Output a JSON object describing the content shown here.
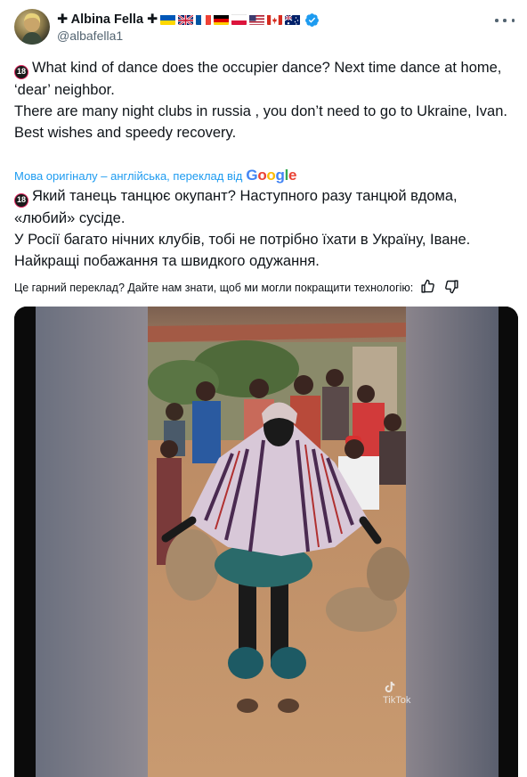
{
  "author": {
    "display_name": "✚ Albina Fella ✚",
    "handle": "@albafella1",
    "verified": true,
    "flags": [
      "ukraine",
      "united-kingdom",
      "france",
      "germany",
      "poland",
      "usa",
      "canada",
      "australia"
    ]
  },
  "tweet": {
    "age_icon": "18",
    "lines": [
      "What kind of dance does the occupier dance? Next time dance at home, ‘dear’ neighbor.",
      "There are many night clubs in russia , you don’t need to go to Ukraine, Ivan.",
      "Best wishes and speedy recovery."
    ]
  },
  "translation": {
    "label": "Мова оригіналу – англійська, переклад від",
    "provider": "Google",
    "lines": [
      "Який танець танцює окупант? Наступного разу танцюй вдома, «любий» сусіде.",
      "У Росії багато нічних клубів, тобі не потрібно їхати в Україну, Іване.",
      "Найкращі побажання та швидкого одужання."
    ]
  },
  "feedback": {
    "question": "Це гарний переклад? Дайте нам знати, щоб ми могли покращити технологію:"
  },
  "media": {
    "watermark": "TikTok"
  },
  "colors": {
    "link": "#1d9bf0",
    "text": "#0f1419",
    "secondary": "#536471",
    "verified": "#1d9bf0"
  }
}
